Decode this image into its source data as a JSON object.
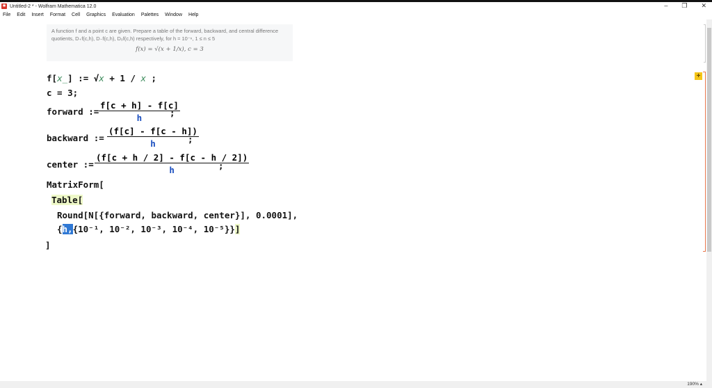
{
  "window": {
    "title": "Untitled-2 * - Wolfram Mathematica 12.0",
    "minimize": "–",
    "restore": "❐",
    "close": "✕"
  },
  "menu": [
    "File",
    "Edit",
    "Insert",
    "Format",
    "Cell",
    "Graphics",
    "Evaluation",
    "Palettes",
    "Window",
    "Help"
  ],
  "text_cell": {
    "line1": "A function f and a point c are given. Prepare a table of the forward, backward, and central difference",
    "line2": "quotients, D₊f(c,h), D₋f(c,h), D₀f(c,h) respectively, for h = 10⁻ⁿ, 1 ≤ n ≤ 5",
    "formula": "f(x) = √(x + 1/x), c = 3"
  },
  "code": {
    "l1a": "f[",
    "l1x": "x_",
    "l1b": "] := √",
    "l1c": "x",
    "l1d": " + 1 / ",
    "l1e": "x",
    "l1f": " ;",
    "l2": "c = 3;",
    "fwd_lhs": "forward :=",
    "fwd_num": "f[c + h] - f[c]",
    "fwd_den": "h",
    "semi": ";",
    "bwd_lhs": "backward :=",
    "bwd_num": "(f[c] - f[c - h])",
    "bwd_den": "h",
    "ctr_lhs": "center :=",
    "ctr_num": "(f[c + h / 2] - f[c - h / 2])",
    "ctr_den": "h",
    "mf": "MatrixForm[",
    "table": "Table",
    "table_br": "[",
    "round": "Round[N[{forward, backward, center}], 0.0001],",
    "iter_open": "{",
    "iter_h": "h,",
    "iter_list": "{10⁻¹, 10⁻², 10⁻³, 10⁻⁴, 10⁻⁵}}",
    "iter_close": "]",
    "close": "]"
  },
  "cell_insert": "+",
  "status": {
    "zoom": "190%"
  }
}
